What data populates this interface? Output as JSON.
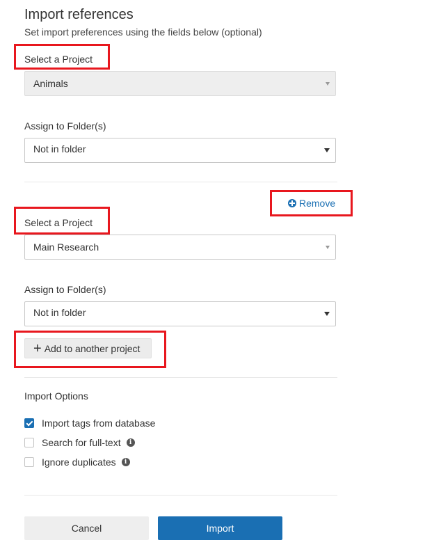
{
  "header": {
    "title": "Import references",
    "subtitle": "Set import preferences using the fields below (optional)"
  },
  "project_blocks": [
    {
      "project_label": "Select a Project",
      "project_value": "Animals",
      "project_disabled": true,
      "folder_label": "Assign to Folder(s)",
      "folder_value": "Not in folder"
    },
    {
      "remove_label": "Remove",
      "project_label": "Select a Project",
      "project_value": "Main Research",
      "project_disabled": false,
      "folder_label": "Assign to Folder(s)",
      "folder_value": "Not in folder"
    }
  ],
  "add_project_label": "Add to another project",
  "import_options": {
    "title": "Import Options",
    "items": [
      {
        "label": "Import tags from database",
        "checked": true,
        "info": false
      },
      {
        "label": "Search for full-text",
        "checked": false,
        "info": true
      },
      {
        "label": "Ignore duplicates",
        "checked": false,
        "info": true
      }
    ]
  },
  "footer": {
    "cancel_label": "Cancel",
    "import_label": "Import"
  },
  "colors": {
    "primary": "#1a6fb3",
    "highlight": "#e8171e"
  },
  "icons": {
    "remove": "circle-plus-icon",
    "add": "plus-icon",
    "info": "info-icon",
    "caret": "caret-down-icon"
  }
}
